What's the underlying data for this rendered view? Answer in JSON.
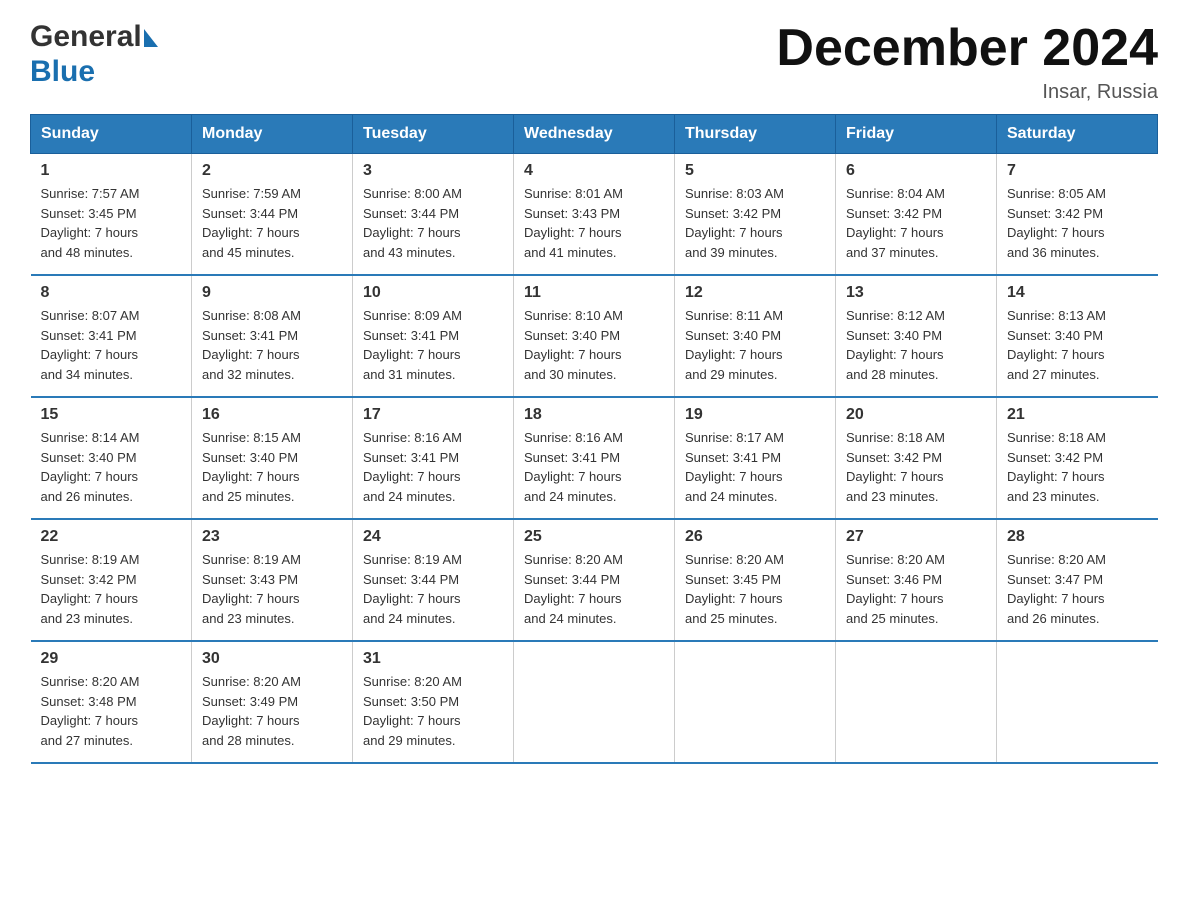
{
  "header": {
    "logo_general": "General",
    "logo_blue": "Blue",
    "title": "December 2024",
    "subtitle": "Insar, Russia"
  },
  "days_of_week": [
    "Sunday",
    "Monday",
    "Tuesday",
    "Wednesday",
    "Thursday",
    "Friday",
    "Saturday"
  ],
  "weeks": [
    [
      {
        "day": "1",
        "info": "Sunrise: 7:57 AM\nSunset: 3:45 PM\nDaylight: 7 hours\nand 48 minutes."
      },
      {
        "day": "2",
        "info": "Sunrise: 7:59 AM\nSunset: 3:44 PM\nDaylight: 7 hours\nand 45 minutes."
      },
      {
        "day": "3",
        "info": "Sunrise: 8:00 AM\nSunset: 3:44 PM\nDaylight: 7 hours\nand 43 minutes."
      },
      {
        "day": "4",
        "info": "Sunrise: 8:01 AM\nSunset: 3:43 PM\nDaylight: 7 hours\nand 41 minutes."
      },
      {
        "day": "5",
        "info": "Sunrise: 8:03 AM\nSunset: 3:42 PM\nDaylight: 7 hours\nand 39 minutes."
      },
      {
        "day": "6",
        "info": "Sunrise: 8:04 AM\nSunset: 3:42 PM\nDaylight: 7 hours\nand 37 minutes."
      },
      {
        "day": "7",
        "info": "Sunrise: 8:05 AM\nSunset: 3:42 PM\nDaylight: 7 hours\nand 36 minutes."
      }
    ],
    [
      {
        "day": "8",
        "info": "Sunrise: 8:07 AM\nSunset: 3:41 PM\nDaylight: 7 hours\nand 34 minutes."
      },
      {
        "day": "9",
        "info": "Sunrise: 8:08 AM\nSunset: 3:41 PM\nDaylight: 7 hours\nand 32 minutes."
      },
      {
        "day": "10",
        "info": "Sunrise: 8:09 AM\nSunset: 3:41 PM\nDaylight: 7 hours\nand 31 minutes."
      },
      {
        "day": "11",
        "info": "Sunrise: 8:10 AM\nSunset: 3:40 PM\nDaylight: 7 hours\nand 30 minutes."
      },
      {
        "day": "12",
        "info": "Sunrise: 8:11 AM\nSunset: 3:40 PM\nDaylight: 7 hours\nand 29 minutes."
      },
      {
        "day": "13",
        "info": "Sunrise: 8:12 AM\nSunset: 3:40 PM\nDaylight: 7 hours\nand 28 minutes."
      },
      {
        "day": "14",
        "info": "Sunrise: 8:13 AM\nSunset: 3:40 PM\nDaylight: 7 hours\nand 27 minutes."
      }
    ],
    [
      {
        "day": "15",
        "info": "Sunrise: 8:14 AM\nSunset: 3:40 PM\nDaylight: 7 hours\nand 26 minutes."
      },
      {
        "day": "16",
        "info": "Sunrise: 8:15 AM\nSunset: 3:40 PM\nDaylight: 7 hours\nand 25 minutes."
      },
      {
        "day": "17",
        "info": "Sunrise: 8:16 AM\nSunset: 3:41 PM\nDaylight: 7 hours\nand 24 minutes."
      },
      {
        "day": "18",
        "info": "Sunrise: 8:16 AM\nSunset: 3:41 PM\nDaylight: 7 hours\nand 24 minutes."
      },
      {
        "day": "19",
        "info": "Sunrise: 8:17 AM\nSunset: 3:41 PM\nDaylight: 7 hours\nand 24 minutes."
      },
      {
        "day": "20",
        "info": "Sunrise: 8:18 AM\nSunset: 3:42 PM\nDaylight: 7 hours\nand 23 minutes."
      },
      {
        "day": "21",
        "info": "Sunrise: 8:18 AM\nSunset: 3:42 PM\nDaylight: 7 hours\nand 23 minutes."
      }
    ],
    [
      {
        "day": "22",
        "info": "Sunrise: 8:19 AM\nSunset: 3:42 PM\nDaylight: 7 hours\nand 23 minutes."
      },
      {
        "day": "23",
        "info": "Sunrise: 8:19 AM\nSunset: 3:43 PM\nDaylight: 7 hours\nand 23 minutes."
      },
      {
        "day": "24",
        "info": "Sunrise: 8:19 AM\nSunset: 3:44 PM\nDaylight: 7 hours\nand 24 minutes."
      },
      {
        "day": "25",
        "info": "Sunrise: 8:20 AM\nSunset: 3:44 PM\nDaylight: 7 hours\nand 24 minutes."
      },
      {
        "day": "26",
        "info": "Sunrise: 8:20 AM\nSunset: 3:45 PM\nDaylight: 7 hours\nand 25 minutes."
      },
      {
        "day": "27",
        "info": "Sunrise: 8:20 AM\nSunset: 3:46 PM\nDaylight: 7 hours\nand 25 minutes."
      },
      {
        "day": "28",
        "info": "Sunrise: 8:20 AM\nSunset: 3:47 PM\nDaylight: 7 hours\nand 26 minutes."
      }
    ],
    [
      {
        "day": "29",
        "info": "Sunrise: 8:20 AM\nSunset: 3:48 PM\nDaylight: 7 hours\nand 27 minutes."
      },
      {
        "day": "30",
        "info": "Sunrise: 8:20 AM\nSunset: 3:49 PM\nDaylight: 7 hours\nand 28 minutes."
      },
      {
        "day": "31",
        "info": "Sunrise: 8:20 AM\nSunset: 3:50 PM\nDaylight: 7 hours\nand 29 minutes."
      },
      {
        "day": "",
        "info": ""
      },
      {
        "day": "",
        "info": ""
      },
      {
        "day": "",
        "info": ""
      },
      {
        "day": "",
        "info": ""
      }
    ]
  ]
}
